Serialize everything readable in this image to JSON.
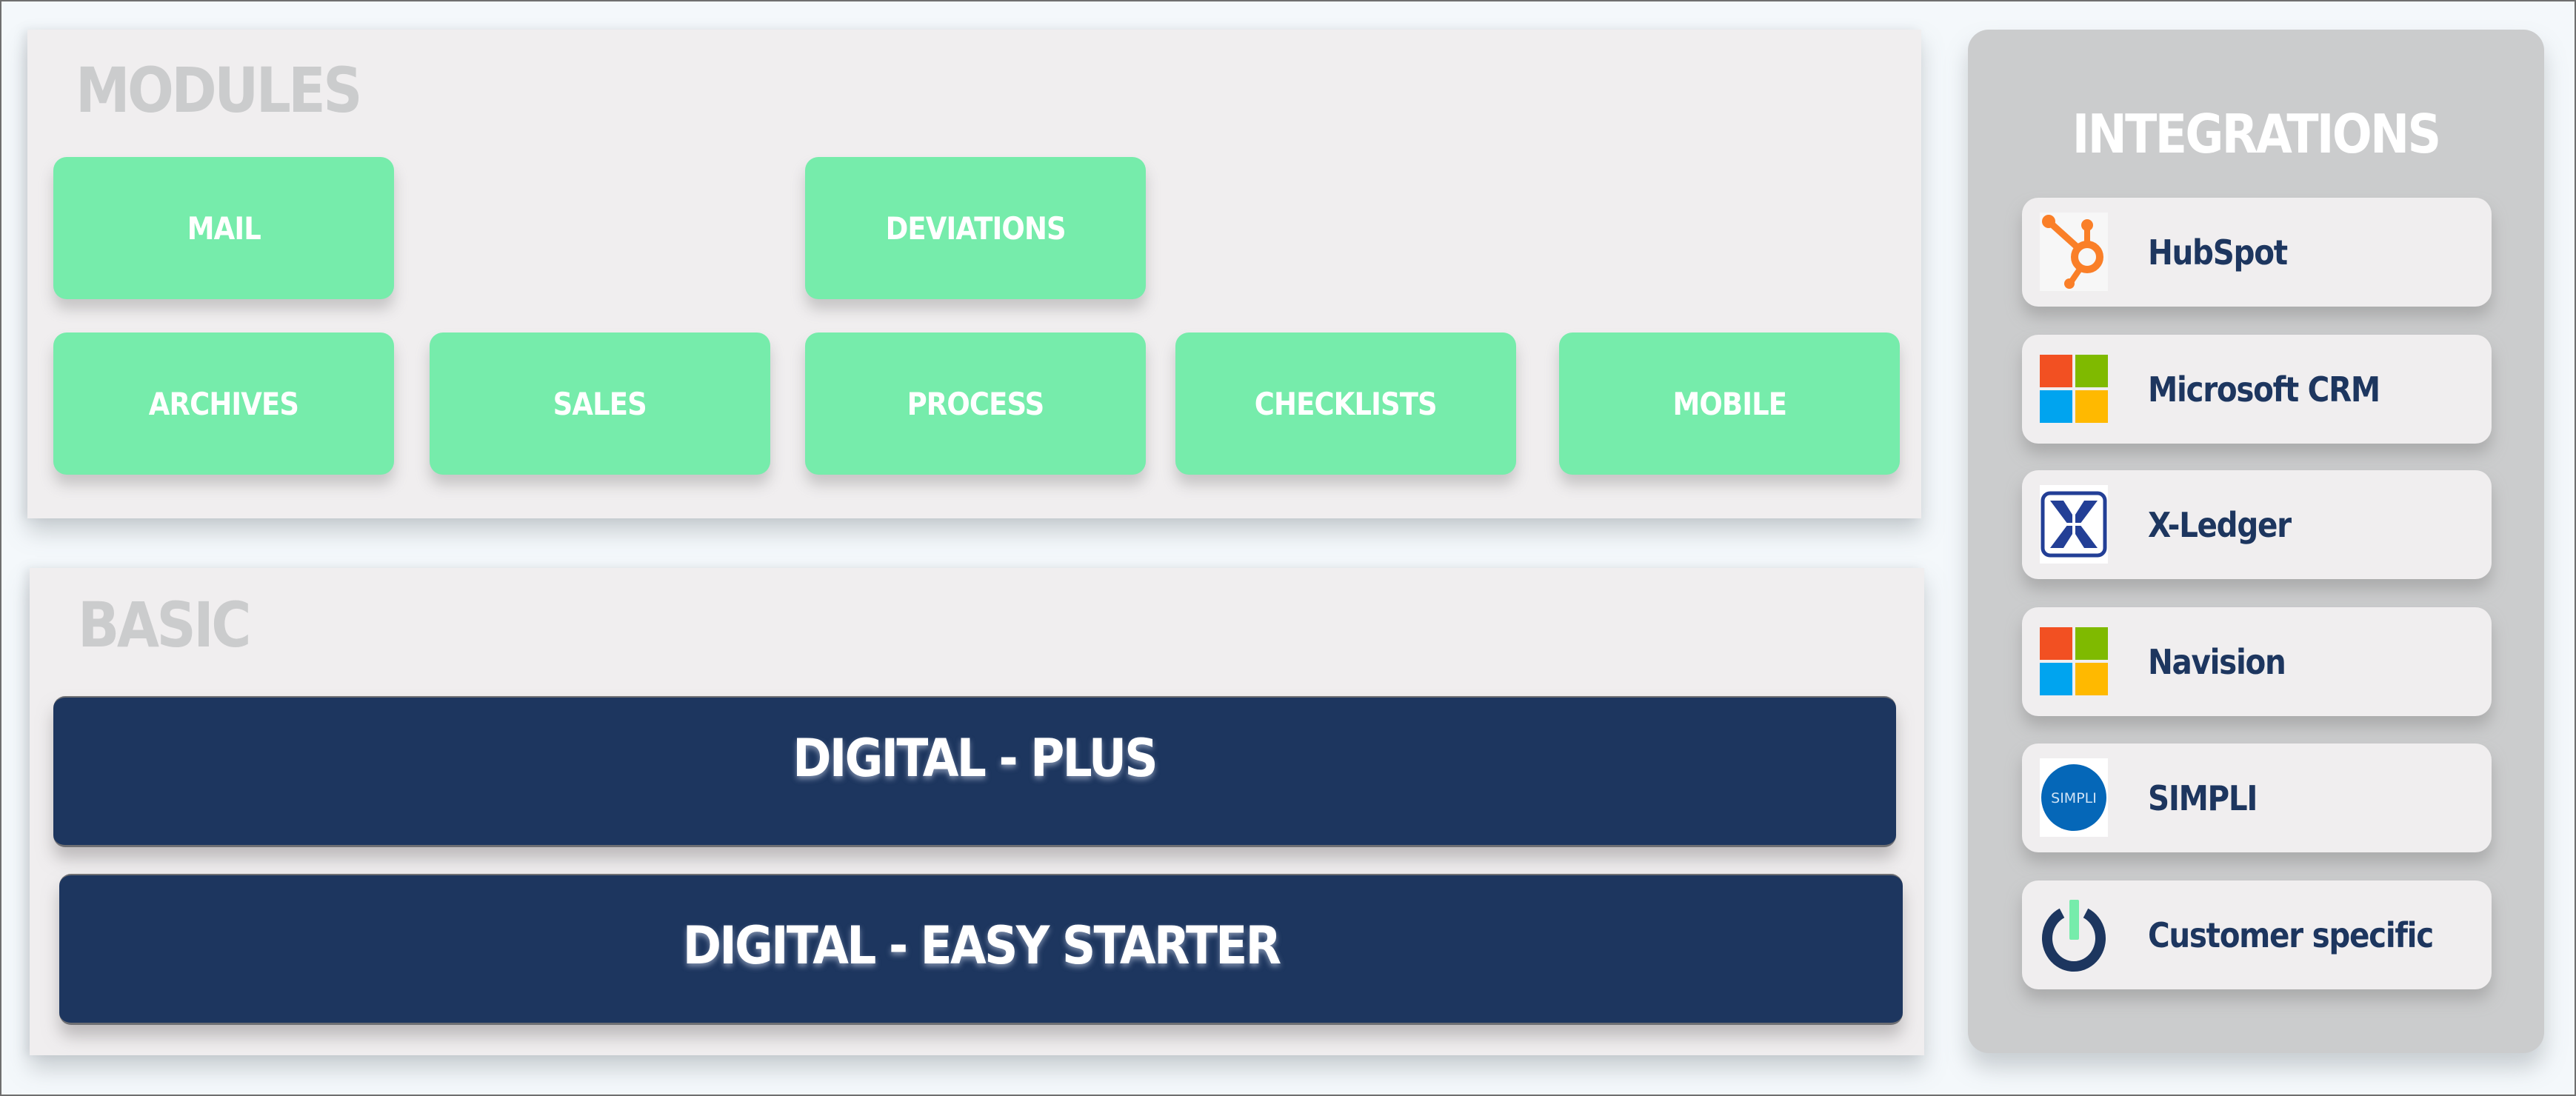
{
  "modules": {
    "title": "MODULES",
    "tiles": [
      {
        "label": "MAIL"
      },
      {
        "label": "DEVIATIONS"
      },
      {
        "label": "ARCHIVES"
      },
      {
        "label": "SALES"
      },
      {
        "label": "PROCESS"
      },
      {
        "label": "CHECKLISTS"
      },
      {
        "label": "MOBILE"
      }
    ]
  },
  "basic": {
    "title": "BASIC",
    "plans": [
      {
        "label": "DIGITAL - PLUS"
      },
      {
        "label": "DIGITAL - EASY STARTER"
      }
    ]
  },
  "integrations": {
    "title": "INTEGRATIONS",
    "items": [
      {
        "label": "HubSpot",
        "icon": "hubspot-logo-icon"
      },
      {
        "label": "Microsoft CRM",
        "icon": "microsoft-logo-icon"
      },
      {
        "label": "X-Ledger",
        "icon": "xledger-logo-icon"
      },
      {
        "label": "Navision",
        "icon": "microsoft-logo-icon"
      },
      {
        "label": "SIMPLI",
        "icon": "simpli-logo-icon",
        "logo_text": "SIMPLI"
      },
      {
        "label": "Customer specific",
        "icon": "power-icon"
      }
    ]
  },
  "colors": {
    "module_green": "#76ecab",
    "plan_navy": "#1d365f",
    "panel_bg": "#f0eeef",
    "integrations_bg": "#cbcccd",
    "title_gray": "#cbcccd",
    "hubspot_orange": "#fa7f28",
    "ms_red": "#f25022",
    "ms_green": "#7fba00",
    "ms_blue": "#00a4ef",
    "ms_yellow": "#ffb900",
    "xledger_blue": "#233f96",
    "simpli_blue": "#0567b8"
  }
}
